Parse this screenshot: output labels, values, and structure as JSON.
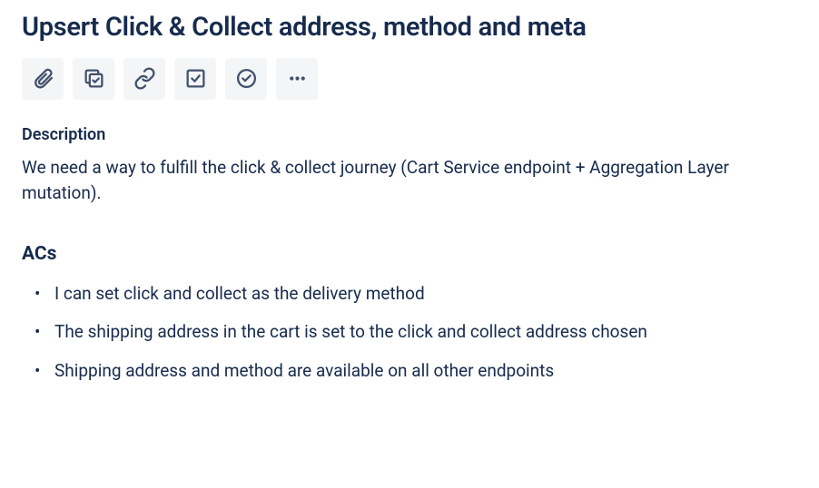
{
  "title": "Upsert Click & Collect address, method and meta",
  "toolbar": {
    "attach_icon": "attachment-icon",
    "checklist_icon": "checklist-icon",
    "link_icon": "link-icon",
    "checkbox_icon": "checkbox-icon",
    "approve_icon": "approval-icon",
    "more_icon": "more-icon"
  },
  "description": {
    "heading": "Description",
    "text": "We need a way to fulfill the click & collect journey (Cart Service endpoint + Aggregation Layer mutation)."
  },
  "acs": {
    "heading": "ACs",
    "items": [
      "I can set click and collect as the delivery method",
      "The shipping address in the cart is set to the click and collect address chosen",
      "Shipping address and method are available on all other endpoints"
    ]
  },
  "colors": {
    "text": "#172B4D",
    "icon": "#42526E",
    "btn_bg": "#F4F5F7"
  }
}
